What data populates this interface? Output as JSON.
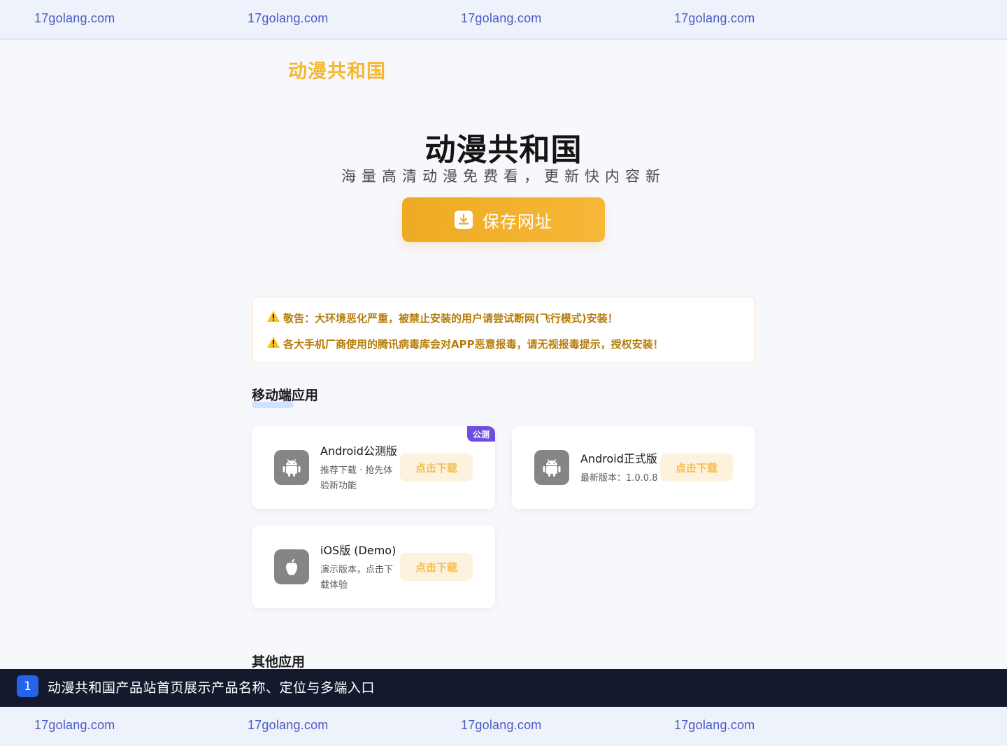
{
  "watermark": {
    "text": "17golang.com"
  },
  "brand": {
    "logo_text": "动漫共和国"
  },
  "hero": {
    "title": "动漫共和国",
    "subtitle": "海量高清动漫免费看，更新快内容新",
    "save_button": {
      "label": "保存网址",
      "icon": "download-icon"
    }
  },
  "warnings": [
    {
      "icon": "warning-icon",
      "text": "敬告：大环境恶化严重，被禁止安装的用户请尝试断网(飞行模式)安装！"
    },
    {
      "icon": "warning-icon",
      "text": "各大手机厂商使用的腾讯病毒库会对APP恶意报毒，请无视报毒提示，授权安装！"
    }
  ],
  "sections": {
    "mobile": {
      "title": "移动端应用"
    },
    "other": {
      "title": "其他应用"
    }
  },
  "apps": [
    {
      "name": "Android公测版",
      "desc": "推荐下载 · 抢先体验新功能",
      "button": "点击下载",
      "badge": "公测",
      "icon": "android-icon"
    },
    {
      "name": "Android正式版",
      "desc": "最新版本：1.0.0.8",
      "button": "点击下载",
      "icon": "android-icon"
    },
    {
      "name": "iOS版 (Demo)",
      "desc": "演示版本，点击下载体验",
      "button": "点击下载",
      "icon": "apple-icon"
    }
  ],
  "caption": {
    "number": "1",
    "text": "动漫共和国产品站首页展示产品名称、定位与多端入口"
  },
  "colors": {
    "accent": "#f5b72f",
    "warning_text": "#b67d0a",
    "badge": "#6c4ee0",
    "caption_bg": "#141a2e"
  }
}
